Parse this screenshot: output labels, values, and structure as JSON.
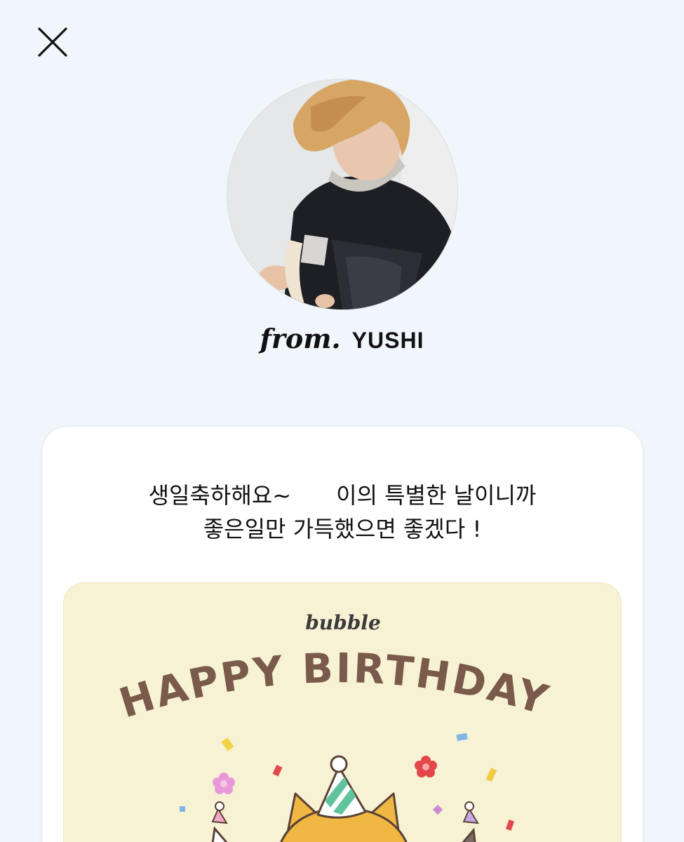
{
  "header": {
    "close_icon": "close-icon"
  },
  "sender": {
    "prefix": "from.",
    "name": "YUSHI"
  },
  "message": {
    "line1_a": "생일축하해요~",
    "line1_b": "이의 특별한 날이니까",
    "line2": "좋은일만 가득했으면 좋겠다 !"
  },
  "birthday_card": {
    "brand": "bubble",
    "headline": "HAPPY BIRTHDAY!"
  },
  "colors": {
    "background": "#f1f6fc",
    "card": "#ffffff",
    "birthday_card_bg": "#f8f2d5",
    "headline": "#7a5a4a"
  }
}
